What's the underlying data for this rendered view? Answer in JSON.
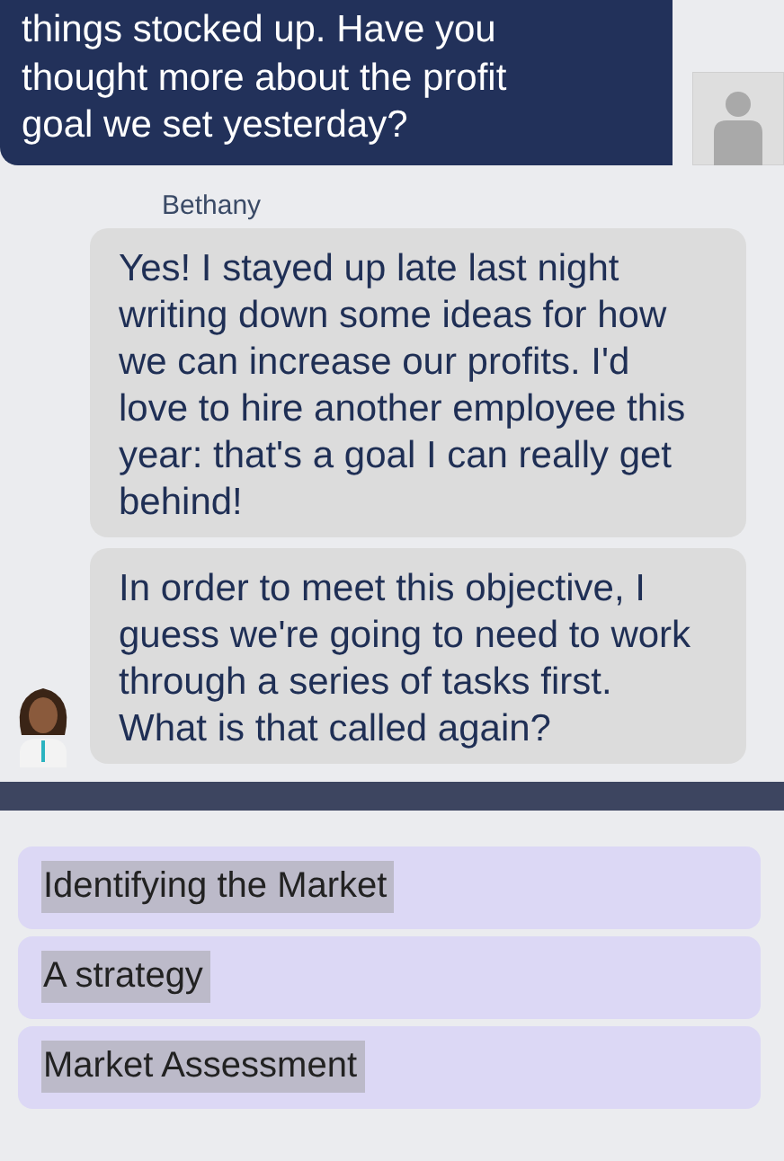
{
  "outgoing_message": {
    "text": "things stocked up. Have you thought more about the profit goal we set yesterday?"
  },
  "incoming": {
    "sender": "Bethany",
    "messages": [
      "Yes! I stayed up late last night writing down some ideas for how we can increase our profits. I'd love to hire another employee this year: that's a goal I can really get behind!",
      "In order to meet this objective, I guess we're going to need to work through a series of tasks first. What is that called again?"
    ]
  },
  "answers": [
    {
      "label": "Identifying the Market"
    },
    {
      "label": "A strategy"
    },
    {
      "label": "Market Assessment"
    }
  ]
}
